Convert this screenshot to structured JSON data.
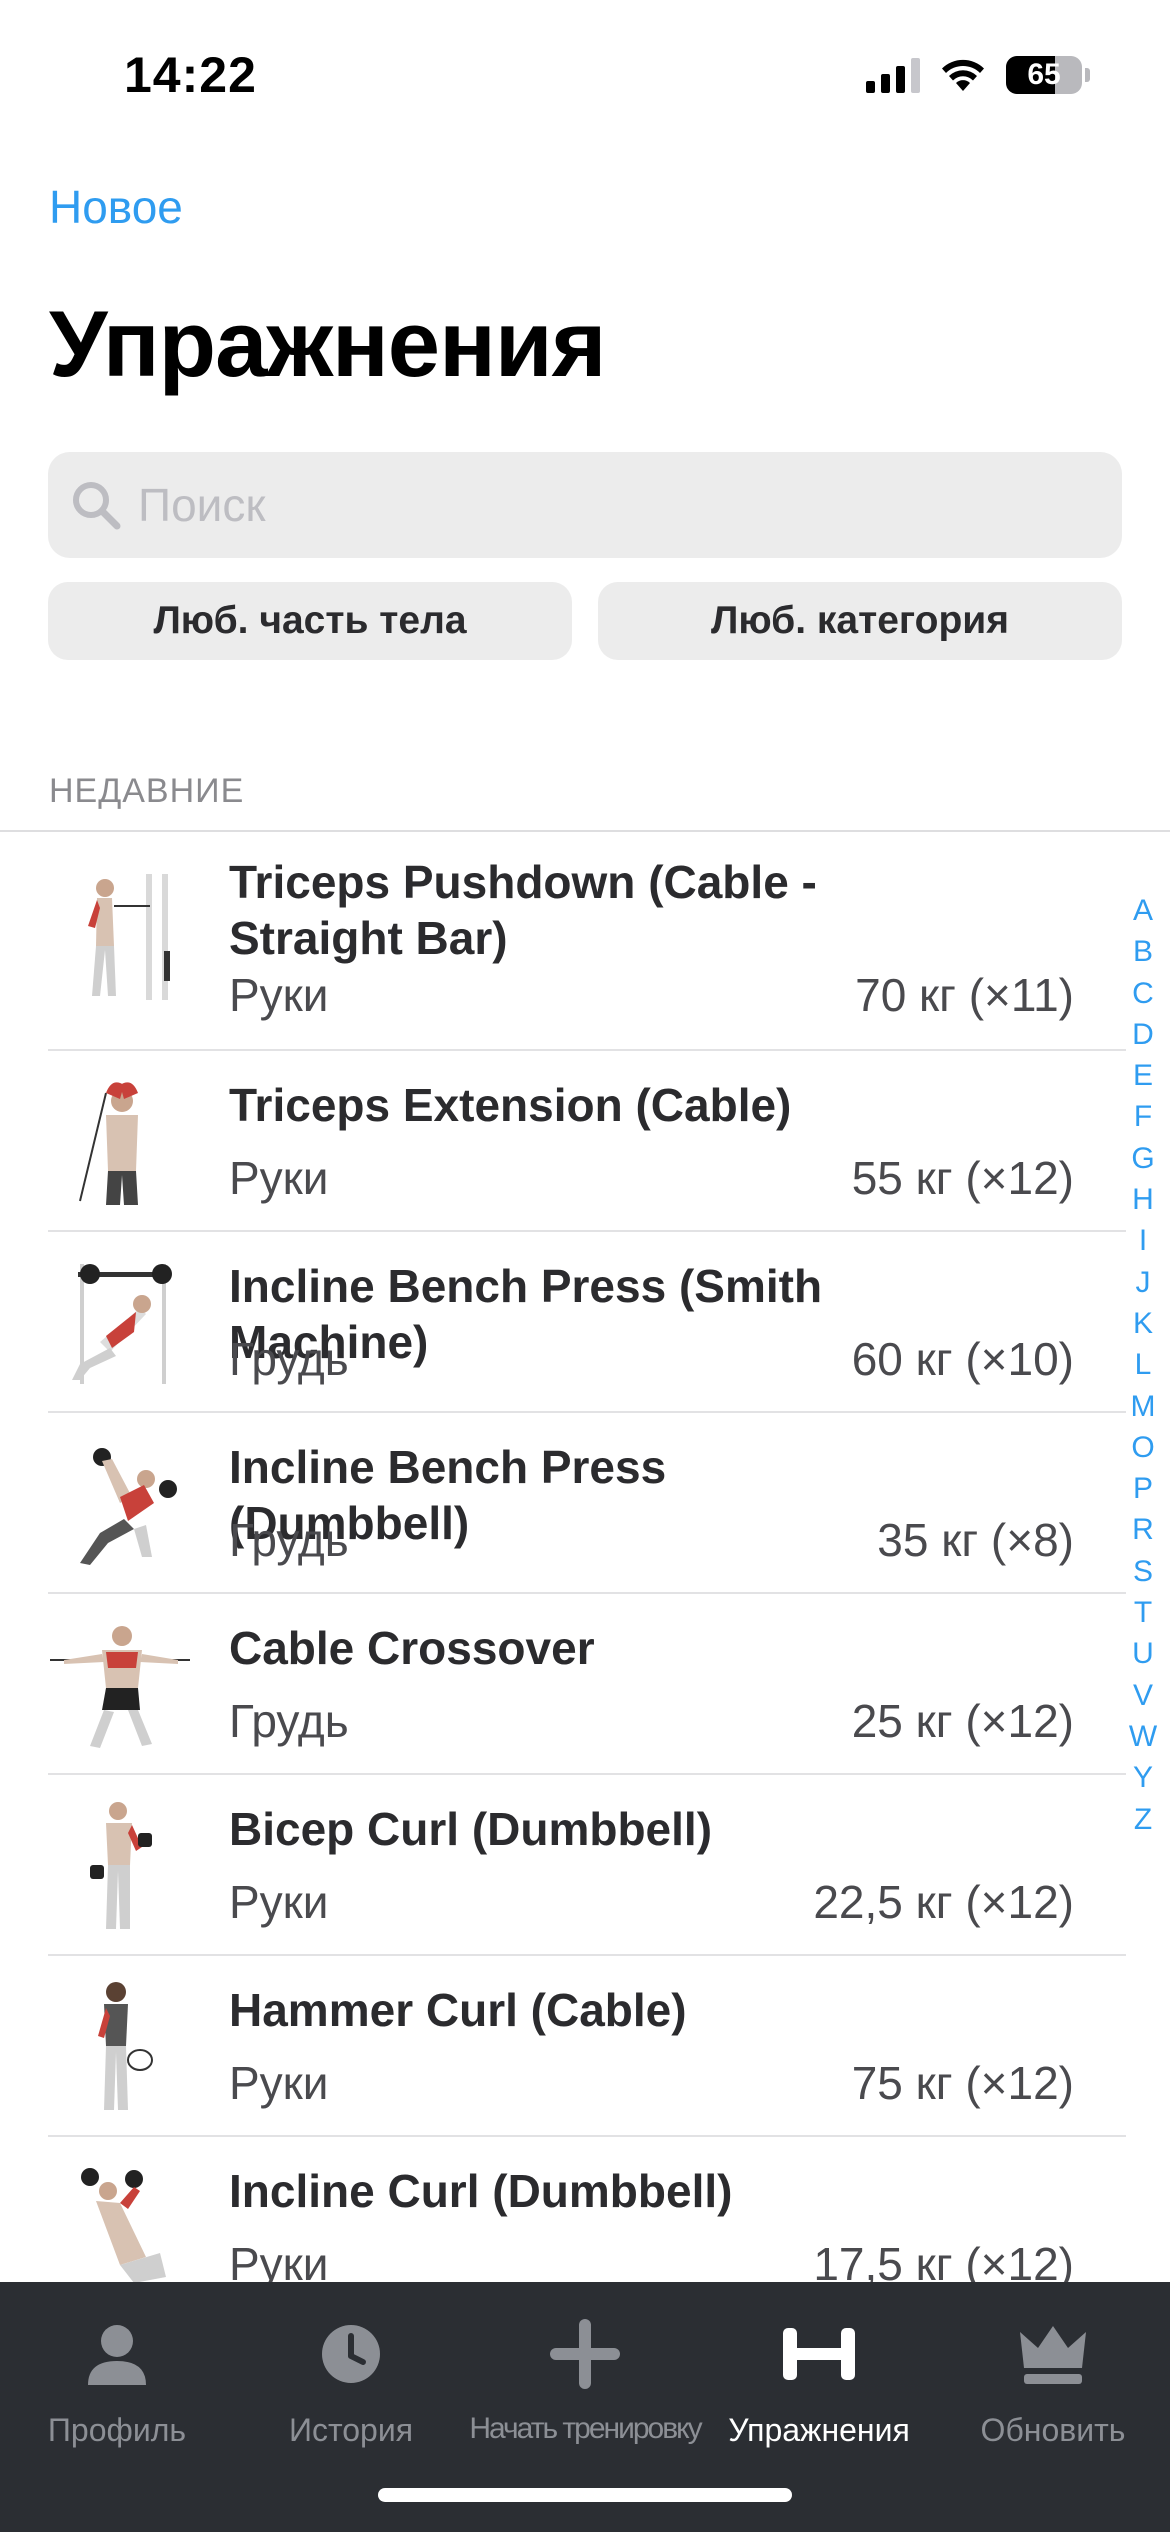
{
  "status": {
    "time": "14:22",
    "battery": "65",
    "battery_level": 0.65
  },
  "header": {
    "new_label": "Новое",
    "title": "Упражнения"
  },
  "search": {
    "placeholder": "Поиск"
  },
  "filters": {
    "body_part": "Люб. часть тела",
    "category": "Люб. категория"
  },
  "section": {
    "label": "НЕДАВНИЕ"
  },
  "exercises": [
    {
      "name": "Triceps Pushdown (Cable - Straight Bar)",
      "body": "Руки",
      "stat": "70 кг (×11)",
      "image": "triceps-pushdown-image"
    },
    {
      "name": "Triceps Extension (Cable)",
      "body": "Руки",
      "stat": "55 кг (×12)",
      "image": "triceps-extension-image"
    },
    {
      "name": "Incline Bench Press (Smith Machine)",
      "body": "Грудь",
      "stat": "60 кг (×10)",
      "image": "incline-bench-smith-image"
    },
    {
      "name": "Incline Bench Press (Dumbbell)",
      "body": "Грудь",
      "stat": "35 кг (×8)",
      "image": "incline-bench-dumbbell-image"
    },
    {
      "name": "Cable Crossover",
      "body": "Грудь",
      "stat": "25 кг (×12)",
      "image": "cable-crossover-image"
    },
    {
      "name": "Bicep Curl (Dumbbell)",
      "body": "Руки",
      "stat": "22,5 кг (×12)",
      "image": "bicep-curl-image"
    },
    {
      "name": "Hammer Curl (Cable)",
      "body": "Руки",
      "stat": "75 кг (×12)",
      "image": "hammer-curl-image"
    },
    {
      "name": "Incline Curl (Dumbbell)",
      "body": "Руки",
      "stat": "17,5 кг (×12)",
      "image": "incline-curl-image"
    }
  ],
  "alphabet": [
    "A",
    "B",
    "C",
    "D",
    "E",
    "F",
    "G",
    "H",
    "I",
    "J",
    "K",
    "L",
    "M",
    "O",
    "P",
    "R",
    "S",
    "T",
    "U",
    "V",
    "W",
    "Y",
    "Z"
  ],
  "tabs": [
    {
      "label": "Профиль",
      "icon": "person-icon",
      "active": false
    },
    {
      "label": "История",
      "icon": "clock-icon",
      "active": false
    },
    {
      "label": "Начать тренировку",
      "icon": "plus-icon",
      "active": false
    },
    {
      "label": "Упражнения",
      "icon": "dumbbell-icon",
      "active": true
    },
    {
      "label": "Обновить",
      "icon": "crown-icon",
      "active": false
    }
  ],
  "colors": {
    "accent": "#2f9cf0",
    "tabbar_bg": "#2b2e33",
    "tab_inactive": "#8c8f95",
    "tab_active": "#ffffff",
    "chip_bg": "#ececec"
  }
}
